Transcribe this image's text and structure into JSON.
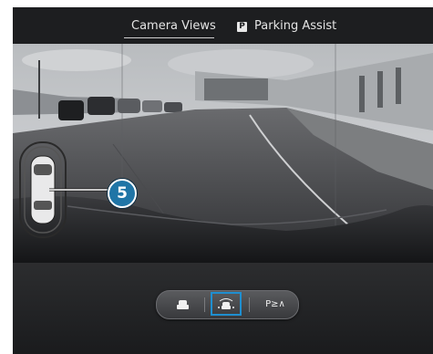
{
  "header": {
    "tabs": [
      {
        "label": "Camera Views",
        "active": true
      },
      {
        "label": "Parking Assist",
        "icon": "parking-p-icon",
        "icon_text": "P",
        "active": false
      }
    ]
  },
  "camera": {
    "callout_number": "5"
  },
  "view_selector": {
    "buttons": [
      {
        "icon": "car-rear-view-icon"
      },
      {
        "icon": "car-topdown-sensor-icon",
        "selected": true
      },
      {
        "icon": "park-pilot-icon",
        "label": "P≥∧"
      }
    ],
    "selected_color": "#1f8fd0"
  }
}
